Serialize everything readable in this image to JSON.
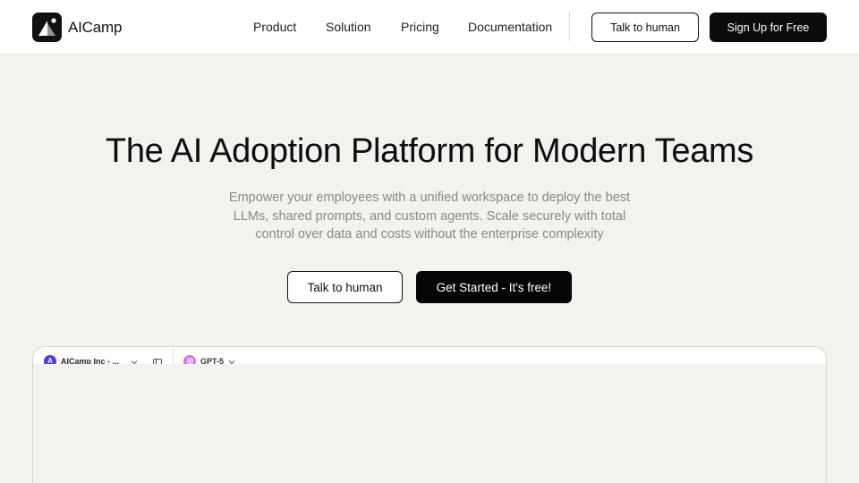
{
  "header": {
    "brand": "AICamp",
    "nav": [
      "Product",
      "Solution",
      "Pricing",
      "Documentation"
    ],
    "talk_label": "Talk to human",
    "signup_label": "Sign Up for Free"
  },
  "hero": {
    "title": "The AI Adoption Platform for Modern Teams",
    "subtitle": "Empower your employees with a unified workspace to deploy the best LLMs, shared prompts, and custom agents. Scale securely with total control over data and costs without the enterprise complexity",
    "secondary_cta": "Talk to human",
    "primary_cta": "Get Started - It's free!"
  },
  "preview": {
    "workspace_initial": "A",
    "workspace_name": "AICamp Inc - ...",
    "model": "GPT-5"
  },
  "colors": {
    "page_bg": "#f3f2ee",
    "primary": "#0b0b0b",
    "workspace_avatar": "#4b3cf0",
    "model_icon": "#c77ce8"
  },
  "icons": {
    "logo": "aicamp-logo-icon",
    "workspace_dropdown": "chevron-down-icon",
    "sidebar": "sidebar-toggle-icon",
    "model": "gpt-model-icon",
    "model_dropdown": "chevron-down-icon"
  }
}
